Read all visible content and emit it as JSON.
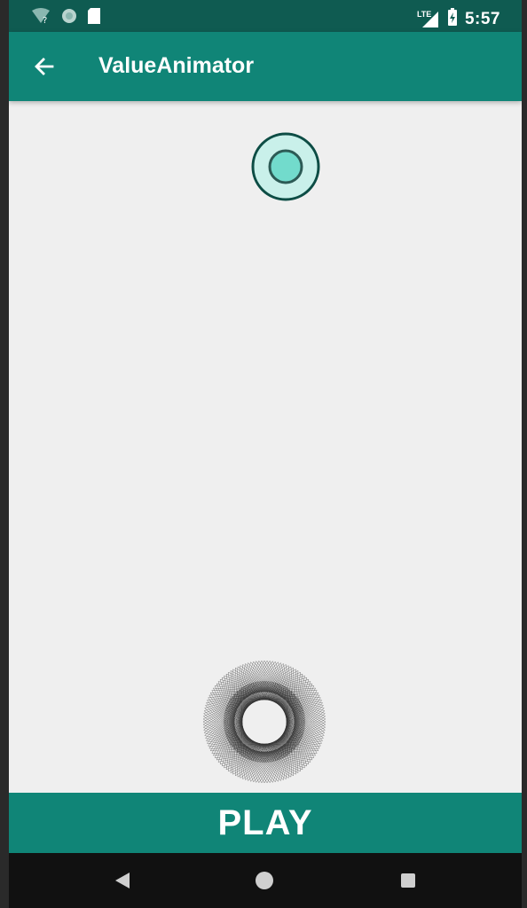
{
  "status_bar": {
    "time": "5:57",
    "network_label": "LTE",
    "icons": [
      "wifi-question-icon",
      "circle-notification-icon",
      "sd-card-icon",
      "signal-icon",
      "battery-charging-icon"
    ]
  },
  "app_bar": {
    "title": "ValueAnimator",
    "back_icon": "arrow-back-icon"
  },
  "content": {
    "animated_ball": "ball",
    "pattern": "spirograph"
  },
  "play_button": {
    "label": "PLAY"
  },
  "nav_bar": {
    "items": [
      "back-nav-icon",
      "home-nav-icon",
      "recents-nav-icon"
    ]
  },
  "colors": {
    "status_bar": "#0f5b51",
    "app_bar": "#108577",
    "background": "#efefef",
    "ball_fill": "#72dbcc",
    "ball_ring": "#c9f0ea"
  }
}
